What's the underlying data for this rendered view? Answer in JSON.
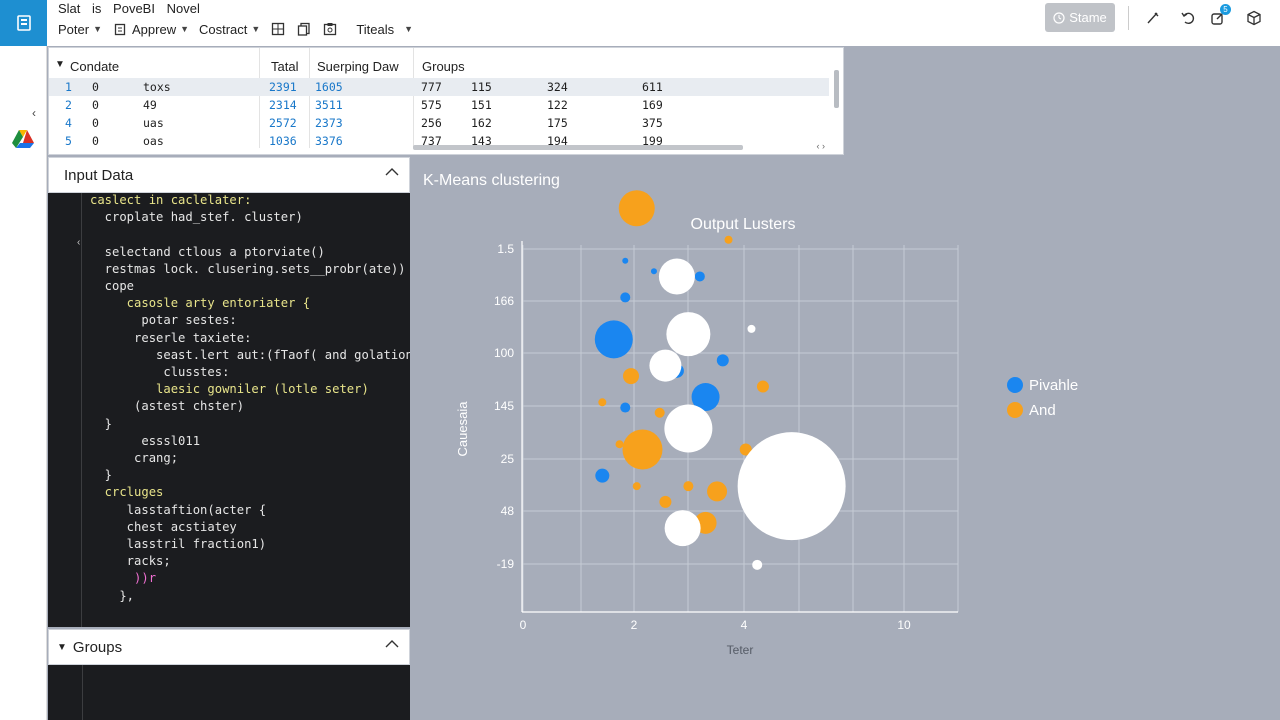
{
  "app": {
    "title_parts": [
      "Slat",
      "is",
      "PoveBI",
      "Novel"
    ],
    "menus": [
      {
        "label": "Poter"
      },
      {
        "label": "Apprew"
      },
      {
        "label": "Costract"
      }
    ],
    "titles_menu": "Titeals",
    "share_label": "Stame",
    "notification_count": "5"
  },
  "table": {
    "headers": [
      "Condate",
      "Tatal",
      "Suerping Daw",
      "Groups"
    ],
    "rows": [
      [
        "1",
        "0",
        "toxs",
        "2391",
        "1605",
        "777",
        "115",
        "324",
        "611"
      ],
      [
        "2",
        "0",
        "49",
        "2314",
        "3511",
        "575",
        "151",
        "122",
        "169"
      ],
      [
        "4",
        "0",
        "uas",
        "2572",
        "2373",
        "256",
        "162",
        "175",
        "375"
      ],
      [
        "5",
        "0",
        "oas",
        "1036",
        "3376",
        "737",
        "143",
        "194",
        "199"
      ]
    ]
  },
  "input_panel": {
    "title": "Input Data",
    "code": [
      {
        "text": "caslect in caclelater:",
        "cls": "kw"
      },
      {
        "text": "  croplate had_stef. cluster)",
        "cls": ""
      },
      {
        "text": "",
        "cls": ""
      },
      {
        "text": "  selectand ctlous a ptorviate()",
        "cls": ""
      },
      {
        "text": "  restmas lock. clusering.sets__probr(ate))",
        "cls": ""
      },
      {
        "text": "  cope",
        "cls": ""
      },
      {
        "text": "     casosle arty entoriater {",
        "cls": "kw"
      },
      {
        "text": "       potar sestes:",
        "cls": ""
      },
      {
        "text": "      reserle taxiete:",
        "cls": ""
      },
      {
        "text": "         seast.lert aut:(fTaof( and golation()",
        "cls": ""
      },
      {
        "text": "          clusstes:",
        "cls": ""
      },
      {
        "text": "         laesic gowniler (lotle seter)",
        "cls": "kw"
      },
      {
        "text": "      (astest chster)",
        "cls": ""
      },
      {
        "text": "  }",
        "cls": ""
      },
      {
        "text": "       esssl011",
        "cls": ""
      },
      {
        "text": "      crang;",
        "cls": ""
      },
      {
        "text": "  }",
        "cls": ""
      },
      {
        "text": "  crcluges",
        "cls": "kw"
      },
      {
        "text": "     lasstaftion(acter {",
        "cls": ""
      },
      {
        "text": "     chest acstiatey",
        "cls": ""
      },
      {
        "text": "     lasstril fraction1)",
        "cls": ""
      },
      {
        "text": "     racks;",
        "cls": ""
      },
      {
        "text": "      ))r",
        "cls": "pk"
      },
      {
        "text": "    },",
        "cls": ""
      }
    ]
  },
  "groups_panel": {
    "title": "Groups"
  },
  "chart_panel": {
    "title": "K-Means clustering"
  },
  "chart_data": {
    "type": "scatter",
    "title": "Output Lusters",
    "xlabel": "Teter",
    "ylabel": "Cauesaia",
    "x_ticks": [
      "0",
      "2",
      "4",
      "10"
    ],
    "y_ticks": [
      "1.5",
      "166",
      "100",
      "145",
      "25",
      "48",
      "-19"
    ],
    "grid": true,
    "legend_position": "right",
    "series": [
      {
        "name": "Pivahle",
        "color": "#1a86f0",
        "points": [
          {
            "x": 1.8,
            "y": 6.7,
            "r": 3
          },
          {
            "x": 2.3,
            "y": 6.5,
            "r": 3
          },
          {
            "x": 1.8,
            "y": 6.0,
            "r": 5
          },
          {
            "x": 3.1,
            "y": 6.4,
            "r": 5
          },
          {
            "x": 1.6,
            "y": 5.2,
            "r": 19
          },
          {
            "x": 2.7,
            "y": 4.6,
            "r": 7
          },
          {
            "x": 3.5,
            "y": 4.8,
            "r": 6
          },
          {
            "x": 3.2,
            "y": 4.1,
            "r": 14
          },
          {
            "x": 1.8,
            "y": 3.9,
            "r": 5
          },
          {
            "x": 1.4,
            "y": 2.6,
            "r": 7
          },
          {
            "x": 3.0,
            "y": 5.0,
            "r": 4
          }
        ]
      },
      {
        "name": "And",
        "color": "#f7a11c",
        "points": [
          {
            "x": 2.0,
            "y": 7.7,
            "r": 18
          },
          {
            "x": 3.6,
            "y": 7.1,
            "r": 4
          },
          {
            "x": 1.9,
            "y": 4.5,
            "r": 8
          },
          {
            "x": 2.4,
            "y": 3.8,
            "r": 5
          },
          {
            "x": 4.2,
            "y": 4.3,
            "r": 6
          },
          {
            "x": 1.7,
            "y": 3.2,
            "r": 4
          },
          {
            "x": 2.1,
            "y": 3.1,
            "r": 20
          },
          {
            "x": 3.9,
            "y": 3.1,
            "r": 6
          },
          {
            "x": 3.4,
            "y": 2.3,
            "r": 10
          },
          {
            "x": 2.9,
            "y": 2.4,
            "r": 5
          },
          {
            "x": 2.0,
            "y": 2.4,
            "r": 4
          },
          {
            "x": 2.5,
            "y": 2.1,
            "r": 6
          },
          {
            "x": 3.2,
            "y": 1.7,
            "r": 11
          },
          {
            "x": 1.4,
            "y": 4.0,
            "r": 4
          }
        ]
      },
      {
        "name": "",
        "color": "#ffffff",
        "points": [
          {
            "x": 2.7,
            "y": 6.4,
            "r": 18
          },
          {
            "x": 2.9,
            "y": 5.3,
            "r": 22
          },
          {
            "x": 2.5,
            "y": 4.7,
            "r": 16
          },
          {
            "x": 2.9,
            "y": 3.5,
            "r": 24
          },
          {
            "x": 4.7,
            "y": 2.4,
            "r": 54
          },
          {
            "x": 2.8,
            "y": 1.6,
            "r": 18
          },
          {
            "x": 4.0,
            "y": 5.4,
            "r": 4
          },
          {
            "x": 4.1,
            "y": 0.9,
            "r": 5
          }
        ]
      }
    ]
  }
}
